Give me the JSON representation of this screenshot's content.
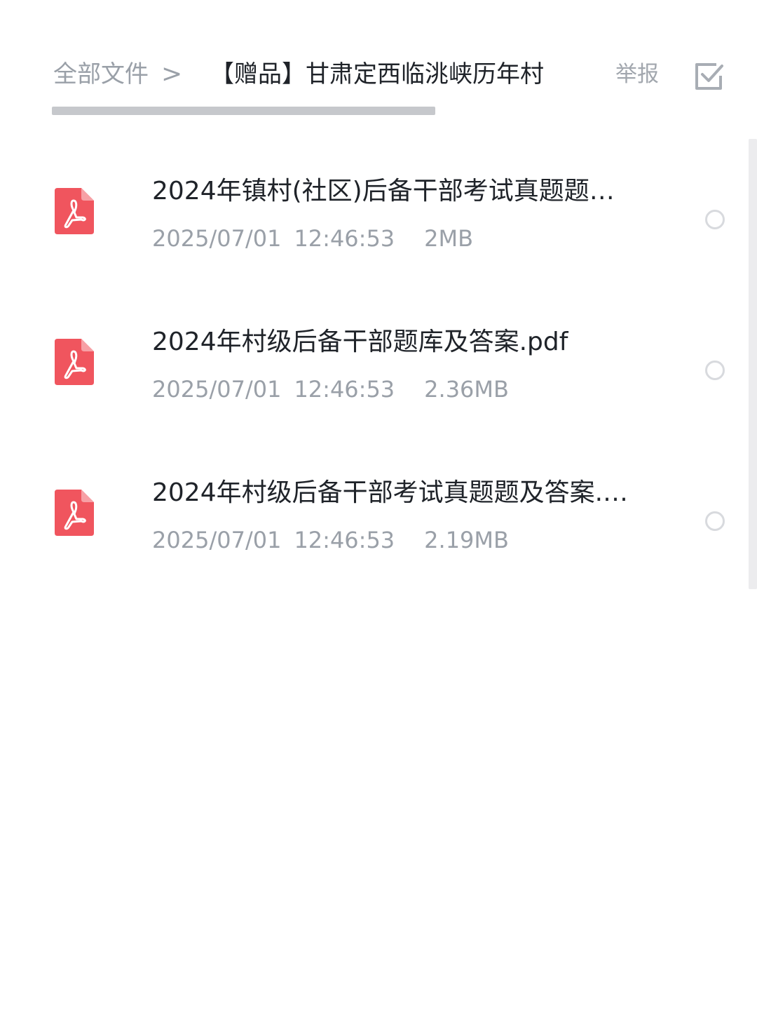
{
  "header": {
    "breadcrumb_root": "全部文件",
    "breadcrumb_separator": ">",
    "breadcrumb_current": "【赠品】甘肃定西临洮峡历年村",
    "report_label": "举报",
    "select_icon": "checkbox-select-icon"
  },
  "files": [
    {
      "name": "2024年镇村(社区)后备干部考试真题题…",
      "date": "2025/07/01",
      "time": "12:46:53",
      "size": "2MB",
      "icon": "pdf-icon",
      "selected": false
    },
    {
      "name": "2024年村级后备干部题库及答案.pdf",
      "date": "2025/07/01",
      "time": "12:46:53",
      "size": "2.36MB",
      "icon": "pdf-icon",
      "selected": false
    },
    {
      "name": "2024年村级后备干部考试真题题及答案.…",
      "date": "2025/07/01",
      "time": "12:46:53",
      "size": "2.19MB",
      "icon": "pdf-icon",
      "selected": false
    }
  ],
  "colors": {
    "pdf_icon": "#f0555e",
    "text_primary": "#1f2329",
    "text_secondary": "#9aa0a8",
    "progress": "#c6c8cc"
  }
}
